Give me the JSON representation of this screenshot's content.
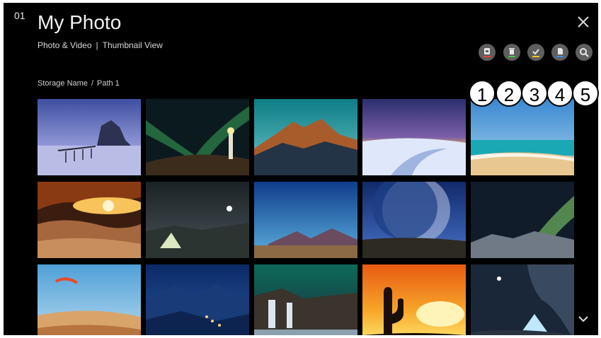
{
  "header": {
    "screen_number": "01",
    "title": "My Photo",
    "subtitle_type": "Photo & Video",
    "subtitle_sep": "|",
    "subtitle_view": "Thumbnail View"
  },
  "breadcrumb": {
    "storage": "Storage Name",
    "sep": "/",
    "path": "Path 1"
  },
  "toolbar": {
    "buttons": [
      {
        "icon": "play-device-icon",
        "accent": "#e8453c"
      },
      {
        "icon": "trash-icon",
        "accent": "#4fbf4a"
      },
      {
        "icon": "check-icon",
        "accent": "#f0c52a"
      },
      {
        "icon": "document-icon",
        "accent": "#3a8ee6"
      },
      {
        "icon": "search-icon",
        "accent": "#ffffff"
      }
    ]
  },
  "callouts": [
    "1",
    "2",
    "3",
    "4",
    "5"
  ],
  "thumbnails": [
    "sea-rock-pier",
    "aurora-lighthouse",
    "mountain-sunrise",
    "desert-dunes-dusk",
    "tropical-beach",
    "canyon-arch-sunset",
    "night-camp-moon",
    "desert-mountain-blue",
    "giant-moon-valley",
    "aurora-rocky-coast",
    "paraglider-dunes",
    "night-town-valley",
    "waterfall-aurora",
    "cactus-sunset",
    "night-tent-cave"
  ]
}
